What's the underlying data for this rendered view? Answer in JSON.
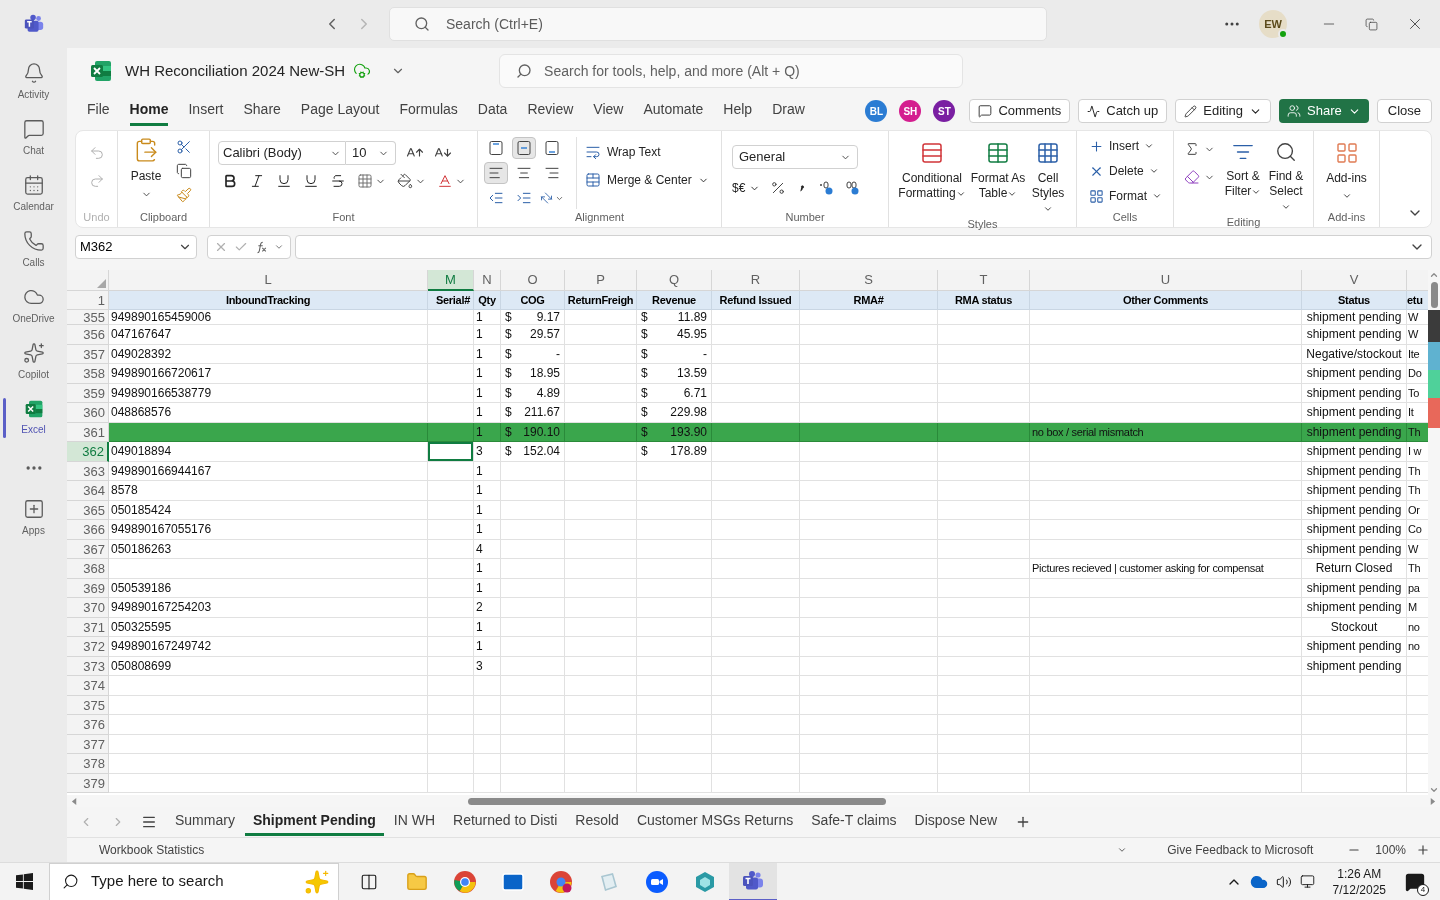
{
  "app": {
    "search_placeholder": "Search (Ctrl+E)",
    "user_initials": "EW",
    "rail": [
      {
        "kind": "activity",
        "label": "Activity",
        "selected": false
      },
      {
        "kind": "chat",
        "label": "Chat",
        "selected": false
      },
      {
        "kind": "calendar",
        "label": "Calendar",
        "selected": false
      },
      {
        "kind": "calls",
        "label": "Calls",
        "selected": false
      },
      {
        "kind": "onedrive",
        "label": "OneDrive",
        "selected": false
      },
      {
        "kind": "copilot",
        "label": "Copilot",
        "selected": false
      },
      {
        "kind": "excel",
        "label": "Excel",
        "selected": true
      },
      {
        "kind": "more"
      },
      {
        "kind": "apps",
        "label": "Apps",
        "selected": false
      }
    ]
  },
  "document": {
    "title": "WH Reconciliation 2024 New-SH",
    "search_placeholder": "Search for tools, help, and more (Alt + Q)"
  },
  "menu_tabs": [
    {
      "label": "File",
      "selected": false
    },
    {
      "label": "Home",
      "selected": true
    },
    {
      "label": "Insert",
      "selected": false
    },
    {
      "label": "Share",
      "selected": false
    },
    {
      "label": "Page Layout",
      "selected": false
    },
    {
      "label": "Formulas",
      "selected": false
    },
    {
      "label": "Data",
      "selected": false
    },
    {
      "label": "Review",
      "selected": false
    },
    {
      "label": "View",
      "selected": false
    },
    {
      "label": "Automate",
      "selected": false
    },
    {
      "label": "Help",
      "selected": false
    },
    {
      "label": "Draw",
      "selected": false
    }
  ],
  "collaborators": [
    {
      "initials": "BL",
      "color": "#2b7cd3"
    },
    {
      "initials": "SH",
      "color": "#d41e8f"
    },
    {
      "initials": "ST",
      "color": "#7a1fa2"
    }
  ],
  "actions": {
    "comments": "Comments",
    "catch_up": "Catch up",
    "editing": "Editing",
    "share": "Share",
    "close": "Close"
  },
  "ribbon": {
    "undo_group": "Undo",
    "paste": "Paste",
    "clipboard_group": "Clipboard",
    "font_name": "Calibri (Body)",
    "font_size": "10",
    "font_group": "Font",
    "vertical_align": [
      {
        "kind": "top",
        "selected": false
      },
      {
        "kind": "middle",
        "selected": true
      },
      {
        "kind": "bottom",
        "selected": false
      }
    ],
    "horizontal_align": [
      {
        "kind": "left",
        "selected": true
      },
      {
        "kind": "center",
        "selected": false
      },
      {
        "kind": "right",
        "selected": false
      }
    ],
    "wrap_text": "Wrap Text",
    "merge_center": "Merge & Center",
    "alignment_group": "Alignment",
    "number_format": "General",
    "currency": "$€",
    "number_group": "Number",
    "conditional_formatting": "Conditional Formatting",
    "format_as_table": "Format As Table",
    "cell_styles": "Cell Styles",
    "styles_group": "Styles",
    "insert": "Insert",
    "delete": "Delete",
    "format": "Format",
    "cells_group": "Cells",
    "sort_filter": "Sort & Filter",
    "find_select": "Find & Select",
    "editing_group": "Editing",
    "add_ins": "Add-ins",
    "add_ins_group": "Add-ins"
  },
  "formula_bar": {
    "name_box": "M362"
  },
  "sheet": {
    "columns": [
      {
        "letter": "L",
        "header": "InboundTracking",
        "selected": false
      },
      {
        "letter": "M",
        "header": "Serial#",
        "selected": true
      },
      {
        "letter": "N",
        "header": "Qty",
        "selected": false
      },
      {
        "letter": "O",
        "header": "COG",
        "selected": false
      },
      {
        "letter": "P",
        "header": "ReturnFreigh",
        "selected": false
      },
      {
        "letter": "Q",
        "header": "Revenue",
        "selected": false
      },
      {
        "letter": "R",
        "header": "Refund Issued",
        "selected": false
      },
      {
        "letter": "S",
        "header": "RMA#",
        "selected": false
      },
      {
        "letter": "T",
        "header": "RMA status",
        "selected": false
      },
      {
        "letter": "U",
        "header": "Other Comments",
        "selected": false
      },
      {
        "letter": "V",
        "header": "Status",
        "selected": false
      },
      {
        "header": "etu",
        "selected": false
      }
    ],
    "header_row": "1",
    "rows": [
      {
        "number": "355",
        "tracking": "949890165459006",
        "qty": "1",
        "cog": {
          "symbol": "$",
          "amount": "9.17"
        },
        "revenue": {
          "symbol": "$",
          "amount": "11.89"
        },
        "status": "shipment pending",
        "col_w": "W",
        "selected": false,
        "highlighted": false
      },
      {
        "number": "356",
        "tracking": "047167647",
        "qty": "1",
        "cog": {
          "symbol": "$",
          "amount": "29.57"
        },
        "revenue": {
          "symbol": "$",
          "amount": "45.95"
        },
        "status": "shipment pending",
        "col_w": "W",
        "selected": false,
        "highlighted": false
      },
      {
        "number": "357",
        "tracking": "049028392",
        "qty": "1",
        "cog": {
          "symbol": "$",
          "amount": "-"
        },
        "revenue": {
          "symbol": "$",
          "amount": "-"
        },
        "status": "Negative/stockout",
        "col_w": "Ite",
        "selected": false,
        "highlighted": false
      },
      {
        "number": "358",
        "tracking": "949890166720617",
        "qty": "1",
        "cog": {
          "symbol": "$",
          "amount": "18.95"
        },
        "revenue": {
          "symbol": "$",
          "amount": "13.59"
        },
        "status": "shipment pending",
        "col_w": "Do",
        "selected": false,
        "highlighted": false
      },
      {
        "number": "359",
        "tracking": "949890166538779",
        "qty": "1",
        "cog": {
          "symbol": "$",
          "amount": "4.89"
        },
        "revenue": {
          "symbol": "$",
          "amount": "6.71"
        },
        "status": "shipment pending",
        "col_w": "To",
        "selected": false,
        "highlighted": false
      },
      {
        "number": "360",
        "tracking": "048868576",
        "qty": "1",
        "cog": {
          "symbol": "$",
          "amount": "211.67"
        },
        "revenue": {
          "symbol": "$",
          "amount": "229.98"
        },
        "status": "shipment pending",
        "col_w": "It",
        "selected": false,
        "highlighted": false
      },
      {
        "number": "361",
        "qty": "1",
        "cog": {
          "symbol": "$",
          "amount": "190.10"
        },
        "revenue": {
          "symbol": "$",
          "amount": "193.90"
        },
        "comment": "no box / serial mismatch",
        "status": "shipment pending",
        "col_w": "Th",
        "selected": false,
        "highlighted": true
      },
      {
        "number": "362",
        "tracking": "049018894",
        "qty": "3",
        "cog": {
          "symbol": "$",
          "amount": "152.04"
        },
        "revenue": {
          "symbol": "$",
          "amount": "178.89"
        },
        "status": "shipment pending",
        "col_w": "I w",
        "selected": true,
        "highlighted": false
      },
      {
        "number": "363",
        "tracking": "949890166944167",
        "qty": "1",
        "status": "shipment pending",
        "col_w": "Th",
        "selected": false,
        "highlighted": false
      },
      {
        "number": "364",
        "tracking": "8578",
        "qty": "1",
        "status": "shipment pending",
        "col_w": "Th",
        "selected": false,
        "highlighted": false
      },
      {
        "number": "365",
        "tracking": "050185424",
        "qty": "1",
        "status": "shipment pending",
        "col_w": "Or",
        "selected": false,
        "highlighted": false
      },
      {
        "number": "366",
        "tracking": "949890167055176",
        "qty": "1",
        "status": "shipment pending",
        "col_w": "Co",
        "selected": false,
        "highlighted": false
      },
      {
        "number": "367",
        "tracking": "050186263",
        "qty": "4",
        "status": "shipment pending",
        "col_w": "W",
        "selected": false,
        "highlighted": false
      },
      {
        "number": "368",
        "qty": "1",
        "comment": "Pictures recieved | customer asking for compensat",
        "status": "Return Closed",
        "col_w": "Th",
        "selected": false,
        "highlighted": false
      },
      {
        "number": "369",
        "tracking": "050539186",
        "qty": "1",
        "status": "shipment pending",
        "col_w": "pa",
        "selected": false,
        "highlighted": false
      },
      {
        "number": "370",
        "tracking": "949890167254203",
        "qty": "2",
        "status": "shipment pending",
        "col_w": "M",
        "selected": false,
        "highlighted": false
      },
      {
        "number": "371",
        "tracking": "050325595",
        "qty": "1",
        "status": "Stockout",
        "col_w": "no",
        "selected": false,
        "highlighted": false
      },
      {
        "number": "372",
        "tracking": "949890167249742",
        "qty": "1",
        "status": "shipment pending",
        "col_w": "no",
        "selected": false,
        "highlighted": false
      },
      {
        "number": "373",
        "tracking": "050808699",
        "qty": "3",
        "status": "shipment pending",
        "selected": false,
        "highlighted": false
      },
      {
        "number": "374",
        "selected": false,
        "highlighted": false
      },
      {
        "number": "375",
        "selected": false,
        "highlighted": false
      },
      {
        "number": "376",
        "selected": false,
        "highlighted": false
      },
      {
        "number": "377",
        "selected": false,
        "highlighted": false
      },
      {
        "number": "378",
        "selected": false,
        "highlighted": false
      },
      {
        "number": "379",
        "selected": false,
        "highlighted": false
      }
    ]
  },
  "sheet_tabs": [
    {
      "label": "Summary",
      "selected": false
    },
    {
      "label": "Shipment Pending",
      "selected": true
    },
    {
      "label": "IN WH",
      "selected": false
    },
    {
      "label": "Returned to Disti",
      "selected": false
    },
    {
      "label": "Resold",
      "selected": false
    },
    {
      "label": "Customer MSGs Returns",
      "selected": false
    },
    {
      "label": "Safe-T claims",
      "selected": false
    },
    {
      "label": "Dispose New",
      "selected": false
    }
  ],
  "status_bar": {
    "workbook_statistics": "Workbook Statistics",
    "feedback": "Give Feedback to Microsoft",
    "zoom": "100%"
  },
  "taskbar": {
    "search_placeholder": "Type here to search",
    "time": "1:26 AM",
    "date": "7/12/2025",
    "notifications": "4"
  }
}
